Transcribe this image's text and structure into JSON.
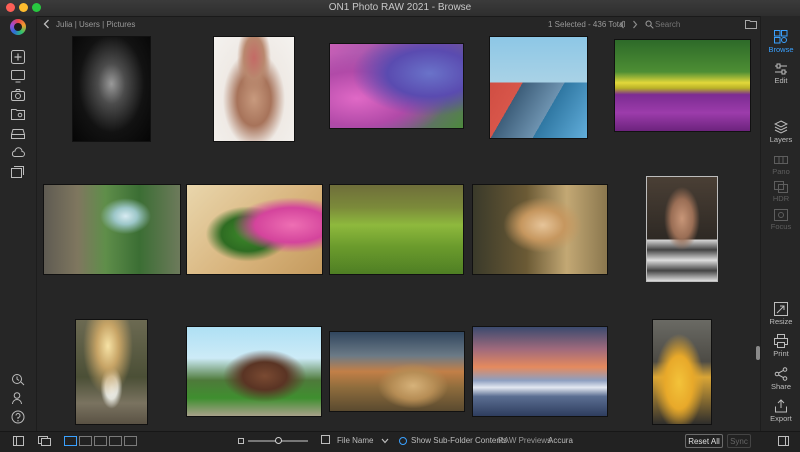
{
  "window": {
    "title": "ON1 Photo RAW 2021 - Browse"
  },
  "path": {
    "segments": [
      "Julia",
      "Users",
      "Pictures"
    ],
    "separator": "|"
  },
  "status": {
    "selection": "1 Selected - 436 Total"
  },
  "search": {
    "placeholder": "Search"
  },
  "colors": {
    "background": "#262626",
    "accent": "#3aa1ff",
    "logo_ring": "#2a6fd6"
  },
  "modules": [
    {
      "label": "Browse",
      "icon": "browse-icon",
      "active": true
    },
    {
      "label": "Edit",
      "icon": "sliders-icon",
      "active": false
    },
    {
      "label": "Layers",
      "icon": "layers-icon",
      "active": false
    },
    {
      "label": "Pano",
      "icon": "pano-icon",
      "active": false,
      "disabled": true
    },
    {
      "label": "HDR",
      "icon": "hdr-icon",
      "active": false,
      "disabled": true
    },
    {
      "label": "Focus",
      "icon": "focus-icon",
      "active": false,
      "disabled": true
    }
  ],
  "actions": [
    {
      "label": "Resize",
      "icon": "resize-icon"
    },
    {
      "label": "Print",
      "icon": "printer-icon"
    },
    {
      "label": "Share",
      "icon": "share-icon"
    },
    {
      "label": "Export",
      "icon": "export-icon"
    }
  ],
  "photos": [
    {
      "name": "bw-portrait-headdress",
      "selected": false
    },
    {
      "name": "woman-flower-crown",
      "selected": false
    },
    {
      "name": "purple-hydrangea",
      "selected": false
    },
    {
      "name": "colorful-buildings",
      "selected": false
    },
    {
      "name": "tulip-field",
      "selected": false
    },
    {
      "name": "waterfall-forest",
      "selected": false
    },
    {
      "name": "pink-rose-leaf",
      "selected": false
    },
    {
      "name": "vineyard-rows",
      "selected": false
    },
    {
      "name": "blonde-woman-sunset",
      "selected": false
    },
    {
      "name": "woman-striped-shirt",
      "selected": true
    },
    {
      "name": "bride-on-rocks",
      "selected": false
    },
    {
      "name": "house-garden",
      "selected": false
    },
    {
      "name": "hay-bale-storm",
      "selected": false
    },
    {
      "name": "snowy-mountains-dusk",
      "selected": false
    },
    {
      "name": "yellow-vw-beetle",
      "selected": false
    }
  ],
  "bottom": {
    "sort": "File Name",
    "subfolders": "Show Sub-Folder Contents",
    "previews": "RAW Previews",
    "accuracy": "Accura",
    "reset": "Reset All",
    "sync": "Sync",
    "thumb_size_level": 0.5
  }
}
